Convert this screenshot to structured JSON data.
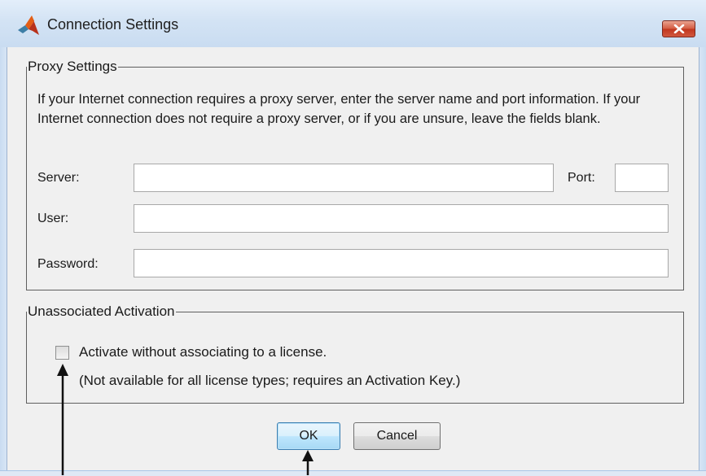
{
  "window": {
    "title": "Connection Settings",
    "close_symbol": "×"
  },
  "proxy": {
    "group_title": "Proxy Settings",
    "description": "If your Internet connection requires a proxy server, enter the server name and port information. If your Internet connection does not require a proxy server, or if you are unsure, leave the fields blank.",
    "server_label": "Server:",
    "server_value": "",
    "port_label": "Port:",
    "port_value": "",
    "user_label": "User:",
    "user_value": "",
    "password_label": "Password:",
    "password_value": ""
  },
  "activation": {
    "group_title": "Unassociated Activation",
    "checkbox_label": "Activate without associating to a license.",
    "checkbox_checked": false,
    "note": "(Not available for all license types; requires an Activation Key.)"
  },
  "buttons": {
    "ok_label": "OK",
    "cancel_label": "Cancel"
  },
  "icons": {
    "app": "matlab-logo-icon",
    "close": "close-icon",
    "annotations": "annotation-arrow-icon"
  },
  "colors": {
    "titlebar": "#d3e3f4",
    "client_bg": "#f0f0f0",
    "close_button": "#c1371e",
    "ok_button_border": "#3c7fb1"
  }
}
